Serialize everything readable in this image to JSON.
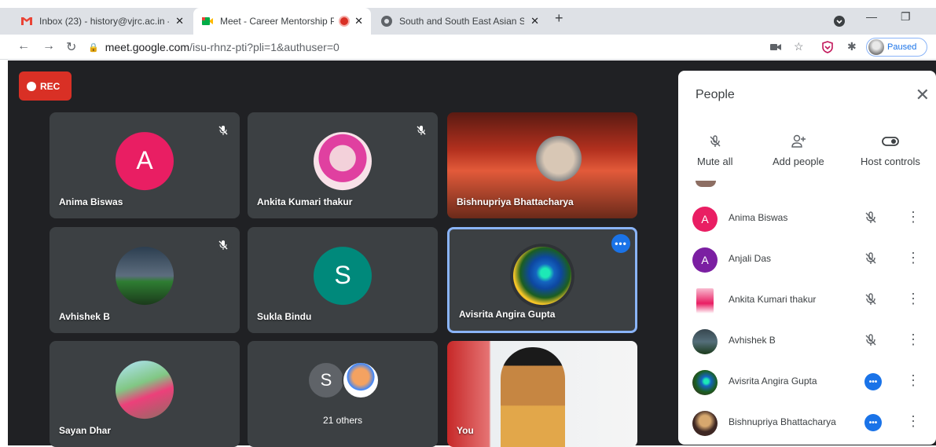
{
  "tabs": [
    {
      "title": "Inbox (23) - history@vjrc.ac.in - v",
      "icon": "gmail-icon",
      "active": false
    },
    {
      "title": "Meet - Career Mentorship Pr",
      "icon": "meet-icon",
      "active": true,
      "recording": true
    },
    {
      "title": "South and South East Asian Stud",
      "icon": "site-icon",
      "active": false
    }
  ],
  "address": {
    "host": "meet.google.com",
    "path": "/isu-rhnz-pti?pli=1&authuser=0"
  },
  "profile": {
    "label": "Paused"
  },
  "rec_label": "REC",
  "tiles": [
    {
      "name": "Anima Biswas",
      "initial": "A",
      "color": "#e91e63",
      "muted": true
    },
    {
      "name": "Ankita Kumari thakur",
      "muted": true
    },
    {
      "name": "Bishnupriya Bhattacharya"
    },
    {
      "name": "Avhishek B",
      "muted": true
    },
    {
      "name": "Sukla Bindu",
      "initial": "S",
      "color": "#00897b"
    },
    {
      "name": "Avisrita Angira Gupta"
    },
    {
      "name": "Sayan Dhar"
    },
    {
      "name": "21 others",
      "initial": "S",
      "color": "#5f6368"
    },
    {
      "name": "You"
    }
  ],
  "panel": {
    "title": "People",
    "actions": [
      {
        "label": "Mute all",
        "icon": "mic-off-icon"
      },
      {
        "label": "Add people",
        "icon": "add-person-icon"
      },
      {
        "label": "Host controls",
        "icon": "toggle-icon"
      }
    ],
    "people": [
      {
        "name": "Anima Biswas",
        "initial": "A",
        "color": "#e91e63",
        "status": "muted"
      },
      {
        "name": "Anjali Das",
        "initial": "A",
        "color": "#7b1fa2",
        "status": "muted"
      },
      {
        "name": "Ankita Kumari thakur",
        "status": "muted"
      },
      {
        "name": "Avhishek B",
        "status": "muted"
      },
      {
        "name": "Avisrita Angira Gupta",
        "status": "speaking"
      },
      {
        "name": "Bishnupriya Bhattacharya",
        "status": "speaking"
      }
    ]
  }
}
